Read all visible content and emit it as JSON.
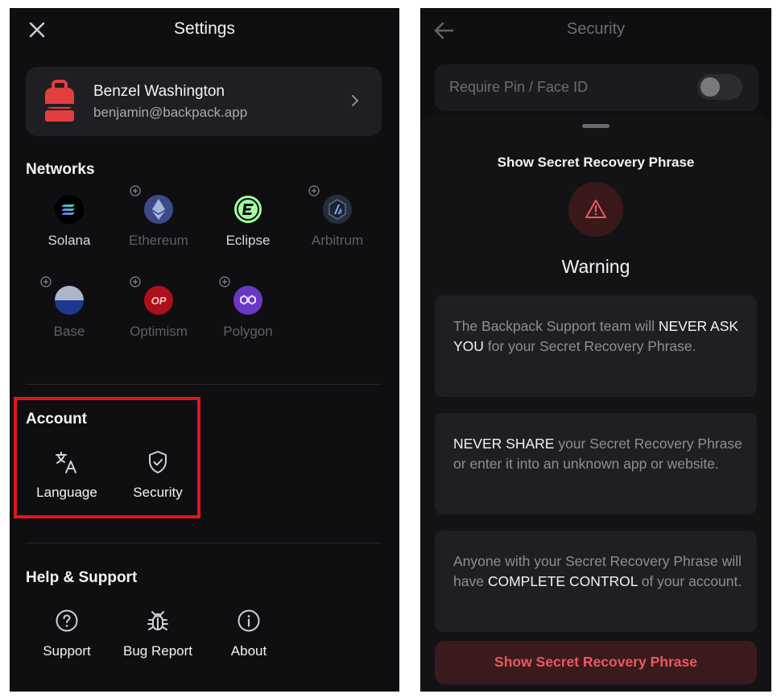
{
  "left": {
    "title": "Settings",
    "profile": {
      "name": "Benzel Washington",
      "email": "benjamin@backpack.app"
    },
    "networks": {
      "title": "Networks",
      "items": [
        {
          "label": "Solana",
          "icon": "solana-icon",
          "enabled": true
        },
        {
          "label": "Ethereum",
          "icon": "ethereum-icon",
          "enabled": false
        },
        {
          "label": "Eclipse",
          "icon": "eclipse-icon",
          "enabled": true
        },
        {
          "label": "Arbitrum",
          "icon": "arbitrum-icon",
          "enabled": false
        },
        {
          "label": "Base",
          "icon": "base-icon",
          "enabled": false
        },
        {
          "label": "Optimism",
          "icon": "optimism-icon",
          "enabled": false,
          "badge": "OP"
        },
        {
          "label": "Polygon",
          "icon": "polygon-icon",
          "enabled": false
        }
      ]
    },
    "account": {
      "title": "Account",
      "items": [
        {
          "label": "Language",
          "icon": "translate-icon"
        },
        {
          "label": "Security",
          "icon": "shield-check-icon"
        }
      ]
    },
    "help": {
      "title": "Help & Support",
      "items": [
        {
          "label": "Support",
          "icon": "question-circle-icon"
        },
        {
          "label": "Bug Report",
          "icon": "bug-icon"
        },
        {
          "label": "About",
          "icon": "info-circle-icon"
        }
      ]
    }
  },
  "right": {
    "title": "Security",
    "pin_row": {
      "label": "Require Pin / Face ID",
      "enabled": false
    },
    "sheet": {
      "title": "Show Secret Recovery Phrase",
      "warning_heading": "Warning",
      "cards": [
        {
          "pre": "The Backpack Support team will ",
          "strong": "NEVER ASK YOU",
          "post": " for your Secret Recovery Phrase."
        },
        {
          "pre": "",
          "strong": "NEVER SHARE",
          "post": " your Secret Recovery Phrase or enter it into an unknown app or website."
        },
        {
          "pre": "Anyone with your Secret Recovery Phrase will have ",
          "strong": "COMPLETE CONTROL",
          "post": " of your account."
        }
      ],
      "button_label": "Show Secret Recovery Phrase"
    }
  },
  "colors": {
    "background": "#0f0f12",
    "card": "#1f1f23",
    "danger": "#e95a5c",
    "danger_bg": "#3b1a1d",
    "highlight": "#e0161b"
  }
}
